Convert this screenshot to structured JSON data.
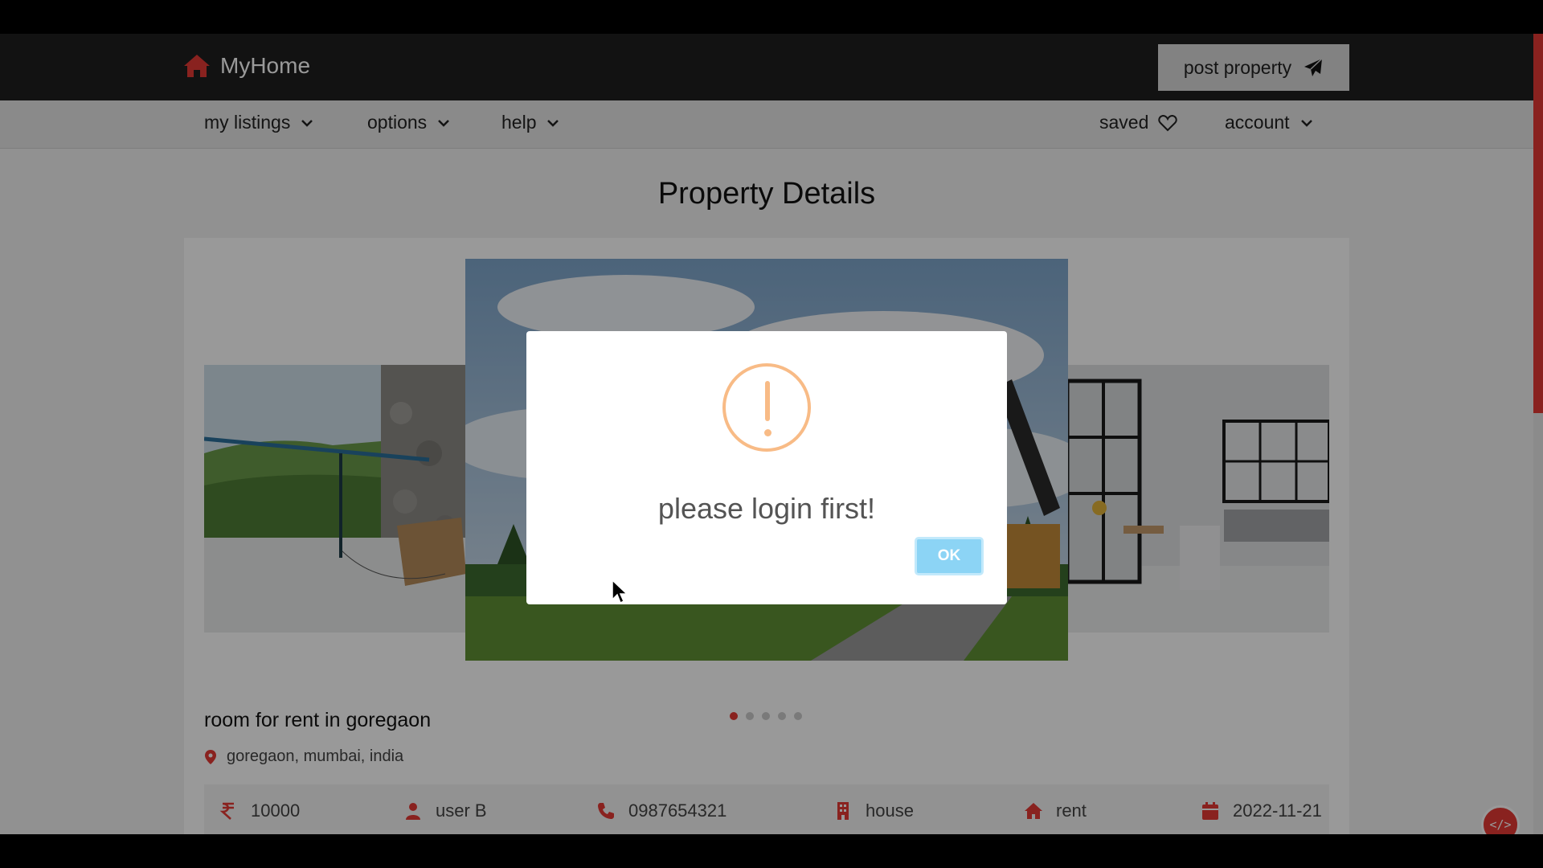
{
  "header": {
    "brand": "MyHome",
    "post_property": "post property"
  },
  "nav": {
    "my_listings": "my listings",
    "options": "options",
    "help": "help",
    "saved": "saved",
    "account": "account"
  },
  "page": {
    "title": "Property Details"
  },
  "carousel": {
    "slide_count": 5,
    "active_index": 0
  },
  "property": {
    "title": "room for rent in goregaon",
    "location": "goregaon, mumbai, india",
    "price": "10000",
    "owner": "user B",
    "phone": "0987654321",
    "type": "house",
    "listing": "rent",
    "date": "2022-11-21"
  },
  "modal": {
    "message": "please login first!",
    "ok": "OK"
  },
  "fab": {
    "label": "</>"
  },
  "colors": {
    "accent": "#e53935",
    "topbar": "#1e1e1e",
    "warning": "#f8bb86",
    "confirm": "#8cd4f5"
  }
}
